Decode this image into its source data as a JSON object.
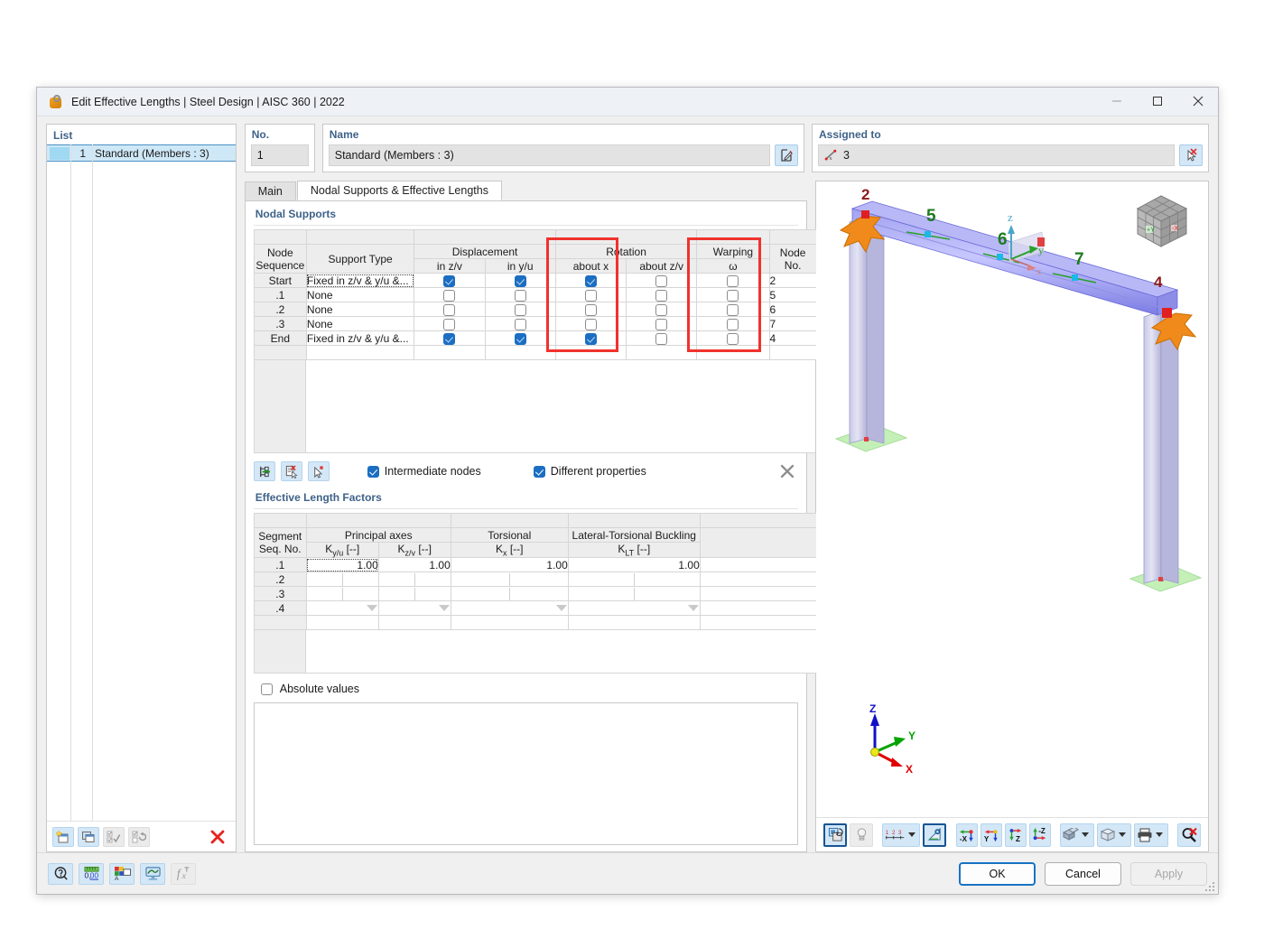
{
  "window": {
    "title": "Edit Effective Lengths | Steel Design | AISC 360 | 2022",
    "minimize": "—",
    "maximize": "□",
    "close": "✕"
  },
  "list": {
    "label": "List",
    "rows": [
      {
        "no": "1",
        "name": "Standard (Members : 3)"
      }
    ],
    "toolbar": [
      {
        "name": "new-entry-button",
        "title": "New"
      },
      {
        "name": "copy-entry-button",
        "title": "Copy"
      },
      {
        "name": "select-all-button",
        "title": "Select All"
      },
      {
        "name": "invert-selection-button",
        "title": "Invert Selection"
      },
      {
        "name": "delete-entry-button",
        "title": "Delete"
      }
    ]
  },
  "no_field": {
    "label": "No.",
    "value": "1"
  },
  "name_field": {
    "label": "Name",
    "value": "Standard (Members : 3)",
    "edit_button": "edit-name-button"
  },
  "assigned": {
    "label": "Assigned to",
    "value": "3",
    "pick_button": "select-members-button"
  },
  "tabs": [
    {
      "label": "Main",
      "active": false
    },
    {
      "label": "Nodal Supports & Effective Lengths",
      "active": true
    }
  ],
  "nodal_supports": {
    "title": "Nodal Supports",
    "group_headers": {
      "displacement": "Displacement",
      "rotation": "Rotation",
      "warping": "Warping"
    },
    "columns": [
      "Node Sequence",
      "Support Type",
      "in z/v",
      "in y/u",
      "about x",
      "about z/v",
      "ω",
      "Node No."
    ],
    "col_line1": [
      "Node",
      "",
      "",
      "",
      "",
      "",
      "",
      "Node"
    ],
    "col_line2": [
      "Sequence",
      "Support Type",
      "in z/v",
      "in y/u",
      "about x",
      "about z/v",
      "ω",
      "No."
    ],
    "rows": [
      {
        "seq": "Start",
        "type": "Fixed in z/v & y/u &...",
        "dz": true,
        "dy": true,
        "rx": true,
        "rz": false,
        "w": false,
        "node": "2",
        "selected": true
      },
      {
        "seq": ".1",
        "type": "None",
        "dz": false,
        "dy": false,
        "rx": false,
        "rz": false,
        "w": false,
        "node": "5",
        "selected": false
      },
      {
        "seq": ".2",
        "type": "None",
        "dz": false,
        "dy": false,
        "rx": false,
        "rz": false,
        "w": false,
        "node": "6",
        "selected": false
      },
      {
        "seq": ".3",
        "type": "None",
        "dz": false,
        "dy": false,
        "rx": false,
        "rz": false,
        "w": false,
        "node": "7",
        "selected": false
      },
      {
        "seq": "End",
        "type": "Fixed in z/v & y/u &...",
        "dz": true,
        "dy": true,
        "rx": true,
        "rz": false,
        "w": false,
        "node": "4",
        "selected": false
      }
    ],
    "highlights": [
      {
        "name": "highlight-rotation-about-x",
        "color": "#f0322d"
      },
      {
        "name": "highlight-warping-omega",
        "color": "#f0322d"
      }
    ],
    "toolbar": [
      {
        "name": "set-nodal-support-button"
      },
      {
        "name": "edit-nodal-support-button"
      },
      {
        "name": "pick-nodal-support-button"
      }
    ],
    "options": [
      {
        "label": "Intermediate nodes",
        "checked": true,
        "name": "intermediate-nodes-checkbox"
      },
      {
        "label": "Different properties",
        "checked": true,
        "name": "different-properties-checkbox"
      }
    ],
    "clear_button": "✕"
  },
  "effective_length_factors": {
    "title": "Effective Length Factors",
    "group_headers": {
      "principal": "Principal axes",
      "torsional": "Torsional",
      "ltb": "Lateral-Torsional Buckling"
    },
    "col_line1": [
      "Segment",
      "",
      "",
      "",
      "",
      ""
    ],
    "col_line2": [
      "Seq. No.",
      "Ky/u [--]",
      "Kz/v [--]",
      "Kx [--]",
      "KLT [--]",
      ""
    ],
    "sub_labels": {
      "kyu_base": "K",
      "kyu_sub": "y/u",
      "kyu_unit": "[--]",
      "kzv_base": "K",
      "kzv_sub": "z/v",
      "kzv_unit": "[--]",
      "kx_base": "K",
      "kx_sub": "x",
      "kx_unit": "[--]",
      "klt_base": "K",
      "klt_sub": "LT",
      "klt_unit": "[--]"
    },
    "rows": [
      {
        "seq": ".1",
        "kyu": "1.00",
        "kzv": "1.00",
        "kx": "1.00",
        "klt": "1.00",
        "focused": true
      },
      {
        "seq": ".2",
        "kyu": "",
        "kzv": "",
        "kx": "",
        "klt": "",
        "focused": false
      },
      {
        "seq": ".3",
        "kyu": "",
        "kzv": "",
        "kx": "",
        "klt": "",
        "focused": false
      },
      {
        "seq": ".4",
        "kyu": "",
        "kzv": "",
        "kx": "",
        "klt": "",
        "focused": false
      }
    ],
    "absolute_values": {
      "label": "Absolute values",
      "checked": false
    }
  },
  "viewport": {
    "nodes": [
      {
        "label": "2",
        "color": "#8b1a1a"
      },
      {
        "label": "5",
        "color": "#1f7a1f"
      },
      {
        "label": "6",
        "color": "#1f7a1f"
      },
      {
        "label": "7",
        "color": "#1f7a1f"
      },
      {
        "label": "4",
        "color": "#8b1a1a"
      }
    ],
    "local_axes": [
      {
        "label": "z",
        "color": "#49a5c8"
      },
      {
        "label": "y",
        "color": "#2aa02a"
      },
      {
        "label": "x",
        "color": "#d05050"
      }
    ],
    "global_axes": [
      {
        "label": "Z",
        "color": "#1010c8"
      },
      {
        "label": "Y",
        "color": "#00a400"
      },
      {
        "label": "X",
        "color": "#e00000"
      }
    ],
    "nav_cube": {
      "front": "+Y",
      "right": "-X"
    },
    "toolbar": [
      {
        "name": "render-mode-button",
        "selected": true
      },
      {
        "name": "lighting-button",
        "disabled": true
      },
      {
        "name": "numbering-button",
        "label": "1 2 3",
        "has_caret": true
      },
      {
        "name": "dimensions-button",
        "selected": true
      },
      {
        "name": "view-in-x-button",
        "label": "-X"
      },
      {
        "name": "view-in-y-button",
        "label": "Y"
      },
      {
        "name": "view-in-z-button",
        "label": "Z"
      },
      {
        "name": "view-in-negative-z-button",
        "label": "-Z"
      },
      {
        "name": "display-mode-button",
        "has_caret": true
      },
      {
        "name": "wireframe-button",
        "has_caret": true
      },
      {
        "name": "print-button",
        "has_caret": true
      },
      {
        "name": "reset-zoom-button"
      }
    ]
  },
  "footer": {
    "left_toolbar": [
      {
        "name": "help-button"
      },
      {
        "name": "units-and-decimal-places-button"
      },
      {
        "name": "display-properties-button"
      },
      {
        "name": "visual-settings-button"
      },
      {
        "name": "formula-button",
        "disabled": true
      }
    ],
    "buttons": [
      {
        "label": "OK",
        "name": "ok-button",
        "primary": true,
        "disabled": false
      },
      {
        "label": "Cancel",
        "name": "cancel-button",
        "primary": false,
        "disabled": false
      },
      {
        "label": "Apply",
        "name": "apply-button",
        "primary": false,
        "disabled": true
      }
    ]
  }
}
